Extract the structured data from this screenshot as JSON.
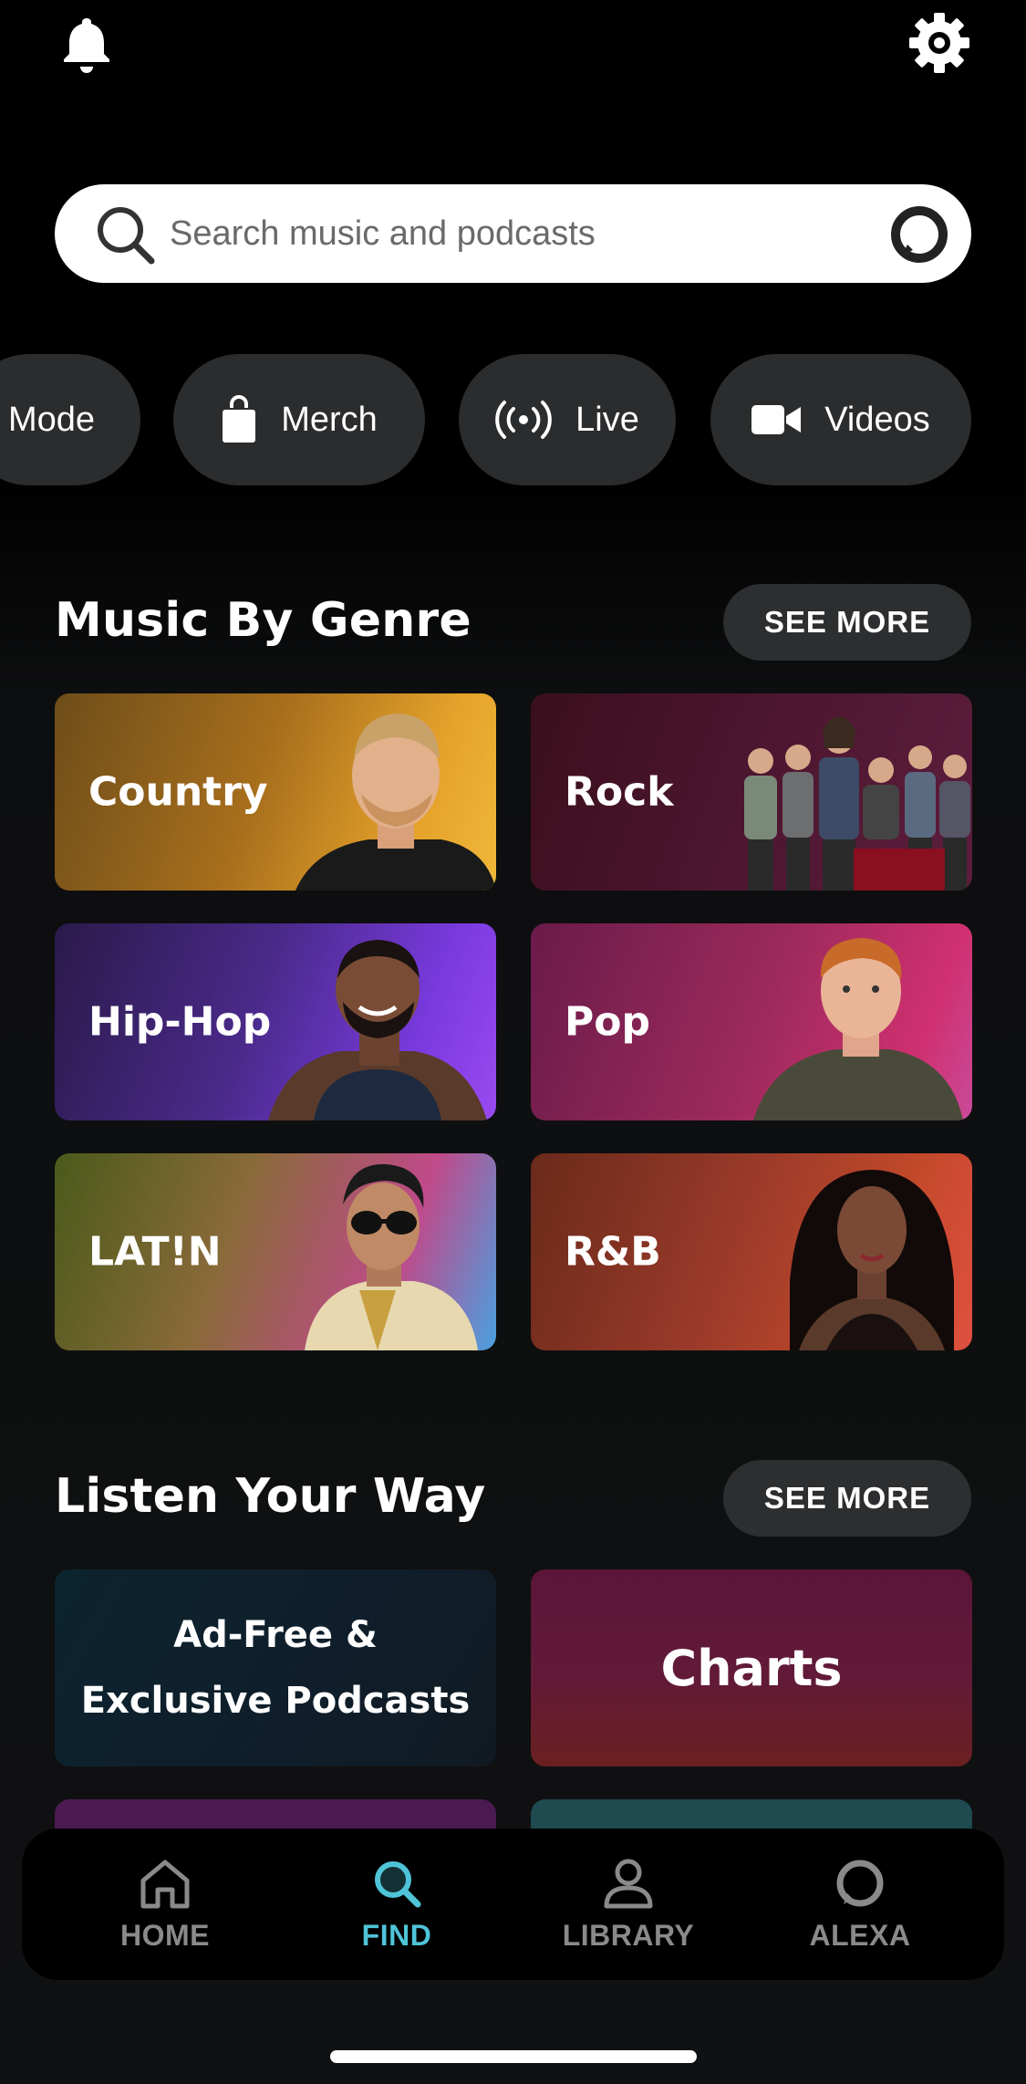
{
  "search": {
    "placeholder": "Search music and podcasts"
  },
  "chips": [
    {
      "label": "Mode"
    },
    {
      "label": "Merch",
      "icon": "shopping-bag-icon"
    },
    {
      "label": "Live",
      "icon": "broadcast-icon"
    },
    {
      "label": "Videos",
      "icon": "video-camera-icon"
    }
  ],
  "genre_section": {
    "title": "Music By Genre",
    "see_more": "SEE MORE",
    "genres": [
      {
        "label": "Country",
        "color": "#c07a1c"
      },
      {
        "label": "Rock",
        "color": "#4a1428"
      },
      {
        "label": "Hip-Hop",
        "color": "#5a2a9a"
      },
      {
        "label": "Pop",
        "color": "#a02a5a"
      },
      {
        "label": "LAT!N",
        "color": "#7a6a2a"
      },
      {
        "label": "R&B",
        "color": "#a0402a"
      }
    ]
  },
  "listen_section": {
    "title": "Listen Your Way",
    "see_more": "SEE MORE",
    "cards": [
      {
        "line1": "Ad-Free &",
        "line2": "Exclusive Podcasts"
      },
      {
        "label": "Charts"
      }
    ]
  },
  "nav": {
    "home": "HOME",
    "find": "FIND",
    "library": "LIBRARY",
    "alexa": "ALEXA",
    "active_color": "#4fc4d8"
  }
}
